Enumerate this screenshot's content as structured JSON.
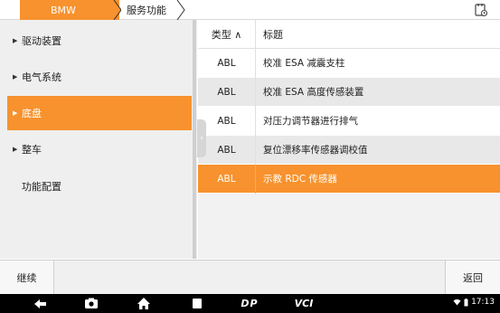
{
  "header": {
    "breadcrumb": [
      "BMW",
      "服务功能"
    ]
  },
  "sidebar": {
    "items": [
      {
        "label": "驱动装置",
        "arrow": "▶",
        "active": false
      },
      {
        "label": "电气系统",
        "arrow": "▶",
        "active": false
      },
      {
        "label": "底盘",
        "arrow": "▶",
        "active": true
      },
      {
        "label": "整车",
        "arrow": "▶",
        "active": false
      },
      {
        "label": "功能配置",
        "arrow": "",
        "active": false
      }
    ]
  },
  "table": {
    "columns": {
      "type": "类型 ∧",
      "title": "标题"
    },
    "rows": [
      {
        "type": "ABL",
        "title": "校准 ESA 减震支柱"
      },
      {
        "type": "ABL",
        "title": "校准 ESA 高度传感装置"
      },
      {
        "type": "ABL",
        "title": "对压力调节器进行排气"
      },
      {
        "type": "ABL",
        "title": "复位漂移率传感器调校值"
      },
      {
        "type": "ABL",
        "title": "示教 RDC 传感器"
      }
    ],
    "selected_index": 4
  },
  "toolbar": {
    "continue_label": "继续",
    "back_label": "返回"
  },
  "navbar": {
    "brand1": "DP",
    "brand2": "VCI",
    "time": "17:13"
  },
  "colors": {
    "accent": "#f7922e",
    "panel_bg": "#efefef",
    "row_alt": "#e8e8e8"
  }
}
